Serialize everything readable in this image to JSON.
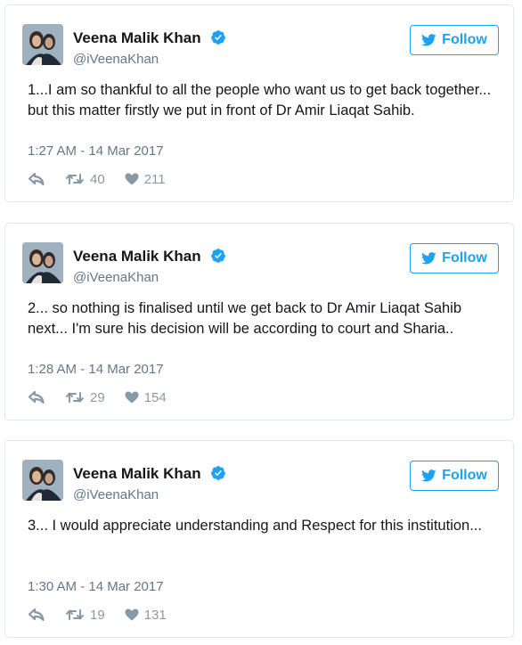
{
  "tweets": [
    {
      "display_name": "Veena Malik Khan",
      "handle": "@iVeenaKhan",
      "follow_label": "Follow",
      "text": "1...I am so thankful to all the people who want us to get back together... but this matter firstly we put in front of Dr Amir Liaqat Sahib.",
      "timestamp": "1:27 AM - 14 Mar 2017",
      "retweets": "40",
      "likes": "211"
    },
    {
      "display_name": "Veena Malik Khan",
      "handle": "@iVeenaKhan",
      "follow_label": "Follow",
      "text": "2... so nothing is finalised until we get back to Dr Amir Liaqat Sahib next... I'm sure his decision will be according to court and Sharia..",
      "timestamp": "1:28 AM - 14 Mar 2017",
      "retweets": "29",
      "likes": "154"
    },
    {
      "display_name": "Veena Malik Khan",
      "handle": "@iVeenaKhan",
      "follow_label": "Follow",
      "text": "3... I would appreciate understanding and Respect for this institution...",
      "timestamp": "1:30 AM - 14 Mar 2017",
      "retweets": "19",
      "likes": "131"
    }
  ],
  "icons": {
    "avatar": "profile-photo",
    "verified": "verified-badge-icon",
    "follow": "twitter-bird-icon",
    "reply": "reply-icon",
    "retweet": "retweet-icon",
    "like": "heart-icon"
  },
  "colors": {
    "twitter_blue": "#1da1f2",
    "secondary_text": "#657786",
    "action_gray": "#8899a6",
    "border": "#e1e8ed"
  }
}
